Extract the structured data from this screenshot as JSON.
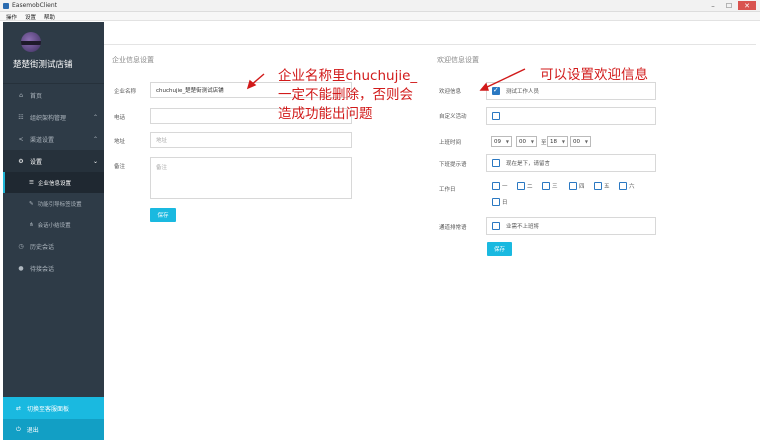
{
  "window": {
    "title": "EasemobClient"
  },
  "menu": [
    "操作",
    "设置",
    "帮助"
  ],
  "sidebar": {
    "brand_name": "楚楚街测试店铺",
    "items": [
      {
        "label": "首页",
        "icon": "home-icon",
        "glyph": "⌂"
      },
      {
        "label": "组织架构管理",
        "icon": "org-chart-icon",
        "glyph": "☷",
        "chevron": "⌃"
      },
      {
        "label": "渠道设置",
        "icon": "share-icon",
        "glyph": "<",
        "chevron": "⌃"
      },
      {
        "label": "设置",
        "icon": "gear-icon",
        "glyph": "⚙",
        "chevron": "⌄"
      }
    ],
    "subitems": [
      {
        "label": "企业信息设置",
        "icon": "list-icon",
        "glyph": "☰"
      },
      {
        "label": "功能引导标签设置",
        "icon": "tag-icon",
        "glyph": "✎"
      },
      {
        "label": "会话小结设置",
        "icon": "sitemap-icon",
        "glyph": "⋔"
      }
    ],
    "items2": [
      {
        "label": "历史会话",
        "icon": "clock-icon",
        "glyph": "◷"
      },
      {
        "label": "待接会话",
        "icon": "chat-icon",
        "glyph": "●"
      }
    ],
    "switch_label": "切换至客服面板",
    "logout_label": "退出"
  },
  "company_settings": {
    "title": "企业信息设置",
    "name_label": "企业名称",
    "name_value": "chuchujie_楚楚街测试店铺",
    "phone_label": "电话",
    "phone_value": "",
    "address_label": "地址",
    "address_placeholder": "地址",
    "remark_label": "备注",
    "remark_placeholder": "备注",
    "save_label": "保存"
  },
  "welcome_settings": {
    "title": "欢迎信息设置",
    "welcome_label": "欢迎信息",
    "welcome_text": "测试工作人员",
    "custom_label": "自定义活动",
    "work_time_label": "上班时间",
    "time": {
      "start_h": "09",
      "start_m": "00",
      "to": "至",
      "end_h": "18",
      "end_m": "00"
    },
    "off_label": "下班提示语",
    "off_text": "现在是下，请留言",
    "workday_label": "工作日",
    "days": [
      "一",
      "二",
      "三",
      "四",
      "五",
      "六",
      "日"
    ],
    "queue_label": "通道排常语",
    "queue_text": "业需不上班将",
    "save_label": "保存"
  },
  "annotations": {
    "left_line1": "企业名称里chuchujie_",
    "left_line2": "一定不能删除，否则会",
    "left_line3": "造成功能出问题",
    "right": "可以设置欢迎信息",
    "color": "#d11a1a"
  }
}
